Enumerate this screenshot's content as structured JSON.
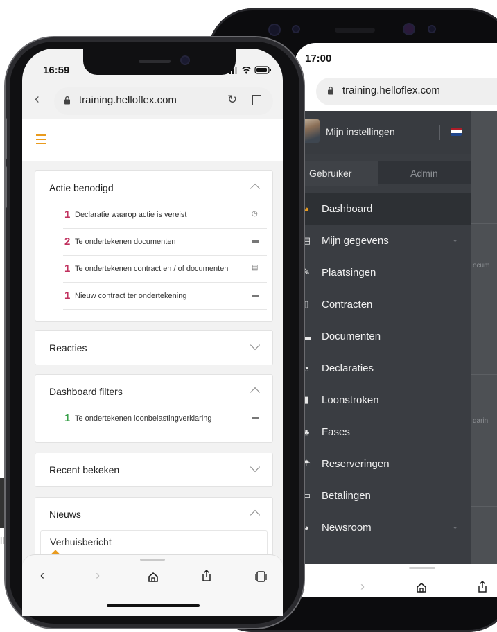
{
  "back_phone": {
    "time": "17:00",
    "url": "training.helloflex.com",
    "user_menu": {
      "settings_label": "Mijn instellingen"
    },
    "tabs": [
      {
        "label": "Gebruiker"
      },
      {
        "label": "Admin"
      }
    ],
    "menu_items": [
      {
        "label": "Dashboard",
        "icon": "dashboard-icon",
        "glyph": "◕",
        "active": true
      },
      {
        "label": "Mijn gegevens",
        "icon": "id-card-icon",
        "glyph": "▤",
        "has_chevron": true
      },
      {
        "label": "Plaatsingen",
        "icon": "edit-icon",
        "glyph": "✎"
      },
      {
        "label": "Contracten",
        "icon": "contract-icon",
        "glyph": "▯"
      },
      {
        "label": "Documenten",
        "icon": "folder-icon",
        "glyph": "▬"
      },
      {
        "label": "Declaraties",
        "icon": "clock-icon",
        "glyph": "◔"
      },
      {
        "label": "Loonstroken",
        "icon": "file-icon",
        "glyph": "▮"
      },
      {
        "label": "Fases",
        "icon": "fases-icon",
        "glyph": "♣"
      },
      {
        "label": "Reserveringen",
        "icon": "reserveringen-icon",
        "glyph": "☂"
      },
      {
        "label": "Betalingen",
        "icon": "credit-card-icon",
        "glyph": "▭"
      },
      {
        "label": "Newsroom",
        "icon": "news-icon",
        "glyph": "◕",
        "has_chevron": true
      }
    ],
    "right_peek_texts": [
      "ocum",
      "darin"
    ],
    "flag_colors": [
      "#ae1c28",
      "#ffffff",
      "#21468b"
    ]
  },
  "front_phone": {
    "time": "16:59",
    "url": "training.helloflex.com",
    "sections": {
      "actie": {
        "title": "Actie benodigd",
        "rows": [
          {
            "count": "1",
            "text": "Declaratie waarop actie is vereist",
            "icon": "clock-icon",
            "glyph": "◷"
          },
          {
            "count": "2",
            "text": "Te ondertekenen documenten",
            "icon": "folder-icon",
            "glyph": "▬"
          },
          {
            "count": "1",
            "text": "Te ondertekenen contract en / of documenten",
            "icon": "contract-icon",
            "glyph": "▤"
          },
          {
            "count": "1",
            "text": "Nieuw contract ter ondertekening",
            "icon": "folder-icon",
            "glyph": "▬"
          }
        ]
      },
      "reacties": {
        "title": "Reacties"
      },
      "filters": {
        "title": "Dashboard filters",
        "rows": [
          {
            "count": "1",
            "text": "Te ondertekenen loonbelastingverklaring",
            "icon": "folder-icon",
            "glyph": "▬"
          }
        ]
      },
      "recent": {
        "title": "Recent bekeken"
      },
      "nieuws": {
        "title": "Nieuws",
        "item_title": "Verhuisbericht"
      }
    }
  },
  "background": {
    "banner_text": "ll"
  },
  "colors": {
    "accent": "#e99b1e",
    "action_count": "#c0315e",
    "filter_count": "#3aa14a",
    "menu_bg": "#3a3d42"
  }
}
